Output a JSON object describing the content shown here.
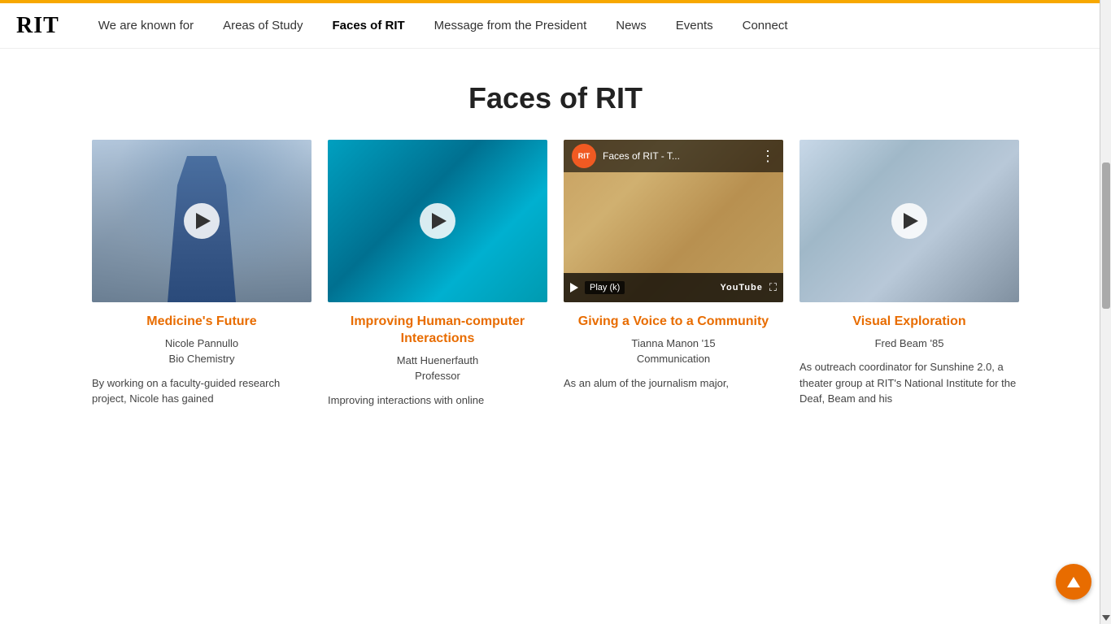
{
  "nav": {
    "logo": "RIT",
    "items": [
      {
        "label": "We are known for",
        "active": false
      },
      {
        "label": "Areas of Study",
        "active": false
      },
      {
        "label": "Faces of RIT",
        "active": true
      },
      {
        "label": "Message from the President",
        "active": false
      },
      {
        "label": "News",
        "active": false
      },
      {
        "label": "Events",
        "active": false
      },
      {
        "label": "Connect",
        "active": false
      }
    ]
  },
  "page": {
    "title": "Faces of RIT"
  },
  "cards": [
    {
      "id": "card-1",
      "type": "photo",
      "title": "Medicine's Future",
      "person_name": "Nicole Pannullo",
      "person_role": "Bio Chemistry",
      "description": "By working on a faculty-guided research project, Nicole has gained",
      "thumb_type": "lab"
    },
    {
      "id": "card-2",
      "type": "video",
      "title": "Improving Human-computer Interactions",
      "person_name": "Matt Huenerfauth",
      "person_role": "Professor",
      "description": "Improving interactions with online",
      "thumb_type": "hci"
    },
    {
      "id": "card-3",
      "type": "youtube",
      "title": "Giving a Voice to a Community",
      "person_name": "Tianna Manon '15",
      "person_role": "Communication",
      "description": "As an alum of the journalism major,",
      "thumb_type": "community",
      "yt_channel": "RIT",
      "yt_title": "Faces of RIT - T...",
      "yt_play_label": "Play (k)"
    },
    {
      "id": "card-4",
      "type": "video",
      "title": "Visual Exploration",
      "person_name": "Fred Beam '85",
      "person_role": "",
      "description": "As outreach coordinator for Sunshine 2.0, a theater group at RIT's National Institute for the Deaf, Beam and his",
      "thumb_type": "theater"
    }
  ],
  "scroll_top_button_label": "↑"
}
